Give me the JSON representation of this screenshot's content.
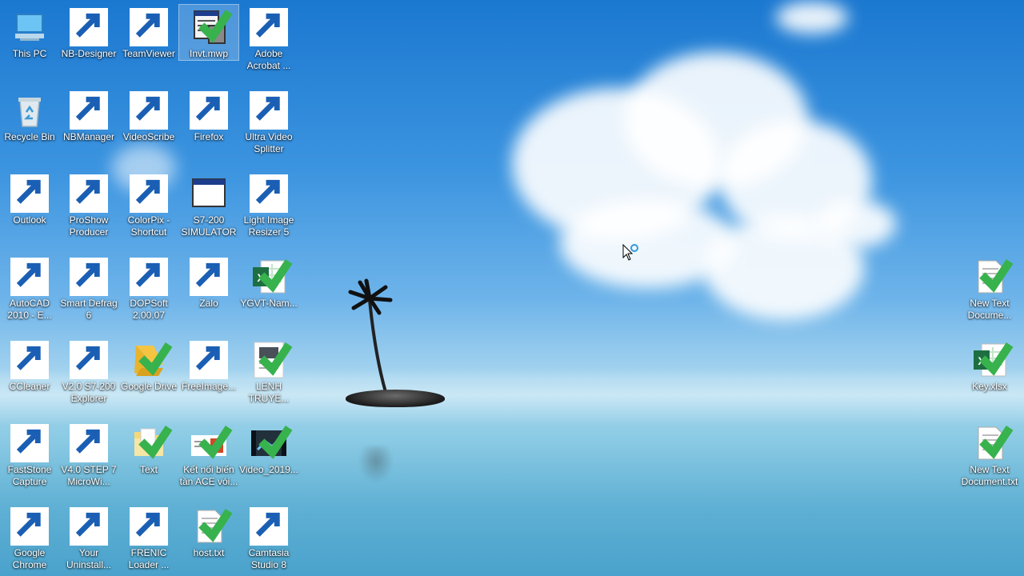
{
  "desktop": {
    "icons": [
      {
        "label": "This PC",
        "icon": "computer-icon"
      },
      {
        "label": "NB-Designer",
        "icon": "nb-designer-icon"
      },
      {
        "label": "TeamViewer",
        "icon": "teamviewer-icon"
      },
      {
        "label": "Invt.mwp",
        "icon": "project-file-icon"
      },
      {
        "label": "Adobe Acrobat ...",
        "icon": "adobe-acrobat-icon"
      },
      {
        "label": "Recycle Bin",
        "icon": "recycle-bin-icon"
      },
      {
        "label": "NBManager",
        "icon": "nbmanager-icon"
      },
      {
        "label": "VideoScribe",
        "icon": "videoscribe-icon"
      },
      {
        "label": "Firefox",
        "icon": "firefox-icon"
      },
      {
        "label": "Ultra Video Splitter",
        "icon": "video-splitter-icon"
      },
      {
        "label": "Outlook",
        "icon": "outlook-icon"
      },
      {
        "label": "ProShow Producer",
        "icon": "proshow-icon"
      },
      {
        "label": "ColorPix - Shortcut",
        "icon": "colorpix-icon"
      },
      {
        "label": "S7-200 SIMULATOR",
        "icon": "window-app-icon"
      },
      {
        "label": "Light Image Resizer 5",
        "icon": "image-resizer-icon"
      },
      {
        "label": "AutoCAD 2010 - E...",
        "icon": "autocad-icon"
      },
      {
        "label": "Smart Defrag 6",
        "icon": "smart-defrag-icon"
      },
      {
        "label": "DOPSoft 2.00.07",
        "icon": "dopsoft-icon"
      },
      {
        "label": "Zalo",
        "icon": "zalo-icon"
      },
      {
        "label": "YGVT-Nam...",
        "icon": "excel-file-icon"
      },
      {
        "label": "CCleaner",
        "icon": "ccleaner-icon"
      },
      {
        "label": "V2.0 S7-200 Explorer",
        "icon": "plc-explorer-icon"
      },
      {
        "label": "Google Drive",
        "icon": "google-drive-icon"
      },
      {
        "label": "FreeImage...",
        "icon": "freeimage-icon"
      },
      {
        "label": "LENH TRUYE...",
        "icon": "pdf-file-icon"
      },
      {
        "label": "FastStone Capture",
        "icon": "faststone-icon"
      },
      {
        "label": "V4.0 STEP 7 MicroWi...",
        "icon": "step7-icon"
      },
      {
        "label": "Text",
        "icon": "folder-icon"
      },
      {
        "label": "Kết nối biến tần ACE vói...",
        "icon": "ppt-file-icon"
      },
      {
        "label": "Video_2019...",
        "icon": "video-file-icon"
      },
      {
        "label": "Google Chrome",
        "icon": "chrome-icon"
      },
      {
        "label": "Your Uninstall...",
        "icon": "uninstaller-icon"
      },
      {
        "label": "FRENIC Loader ...",
        "icon": "frenic-icon"
      },
      {
        "label": "host.txt",
        "icon": "text-file-icon"
      },
      {
        "label": "Camtasia Studio 8",
        "icon": "camtasia-icon"
      },
      {
        "label": "New Text Docume...",
        "icon": "text-file-icon"
      },
      {
        "label": "Key.xlsx",
        "icon": "excel-file-icon"
      },
      {
        "label": "New Text Document.txt",
        "icon": "text-file-icon"
      }
    ],
    "cursor": "busy-cursor-icon"
  }
}
